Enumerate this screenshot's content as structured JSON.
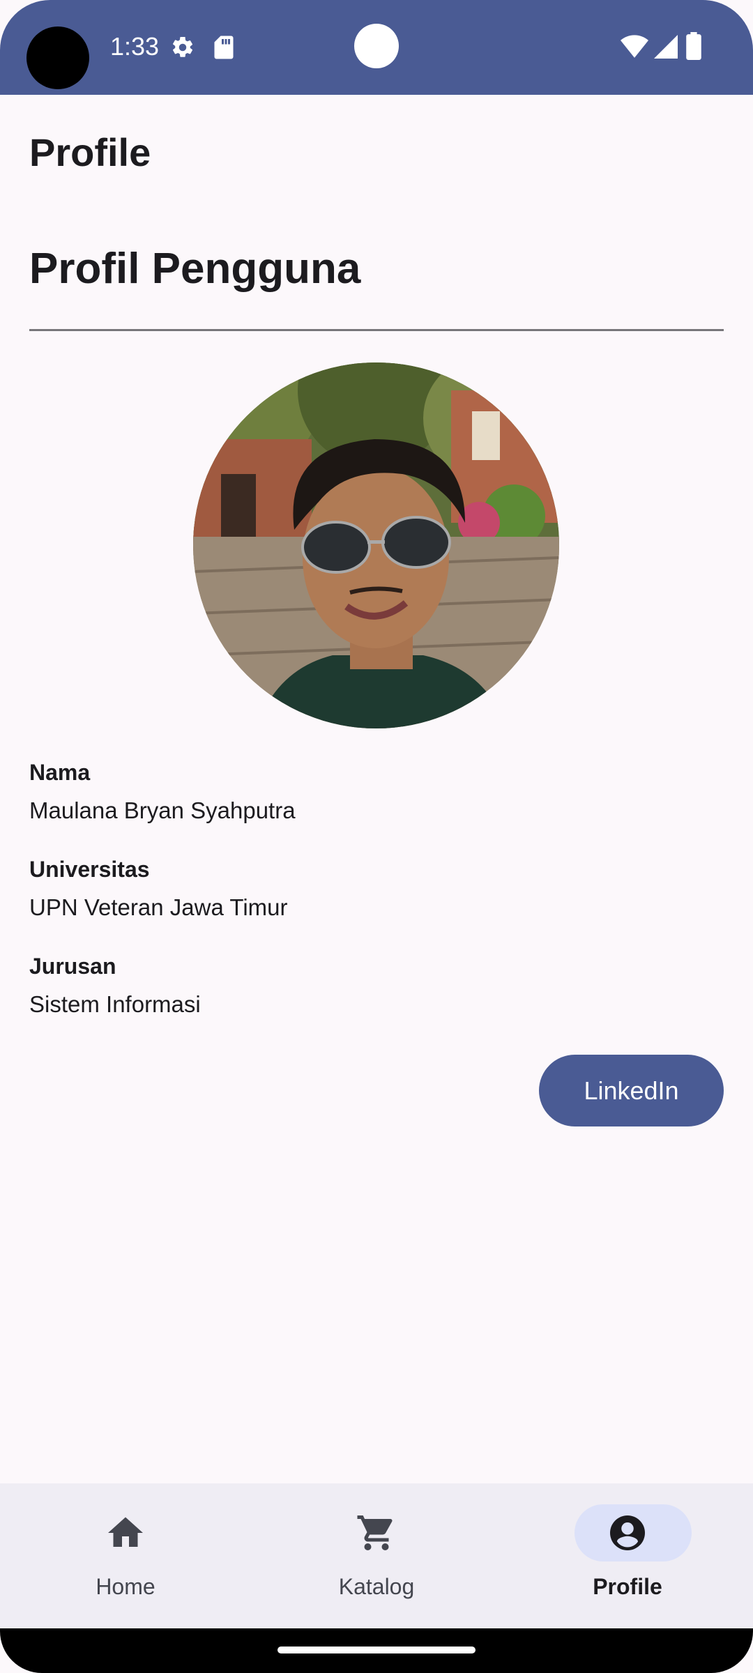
{
  "status_bar": {
    "time": "1:33",
    "icons": [
      "gear-icon",
      "sd-card-icon",
      "wifi-icon",
      "signal-icon",
      "battery-icon"
    ],
    "background": "#4a5b94"
  },
  "app_bar": {
    "title": "Profile"
  },
  "profile": {
    "heading": "Profil Pengguna",
    "avatar_icon": "profile-photo",
    "fields": [
      {
        "label": "Nama",
        "value": "Maulana Bryan Syahputra"
      },
      {
        "label": "Universitas",
        "value": "UPN Veteran Jawa Timur"
      },
      {
        "label": "Jurusan",
        "value": "Sistem Informasi"
      }
    ],
    "linkedin_button": "LinkedIn"
  },
  "bottom_nav": {
    "items": [
      {
        "label": "Home",
        "icon": "home-icon",
        "active": false
      },
      {
        "label": "Katalog",
        "icon": "cart-icon",
        "active": false
      },
      {
        "label": "Profile",
        "icon": "account-circle-icon",
        "active": true
      }
    ],
    "active_indicator_color": "#dce1f9"
  },
  "colors": {
    "primary": "#4a5b94",
    "background": "#fcf8fb",
    "nav_background": "#efedf4"
  }
}
